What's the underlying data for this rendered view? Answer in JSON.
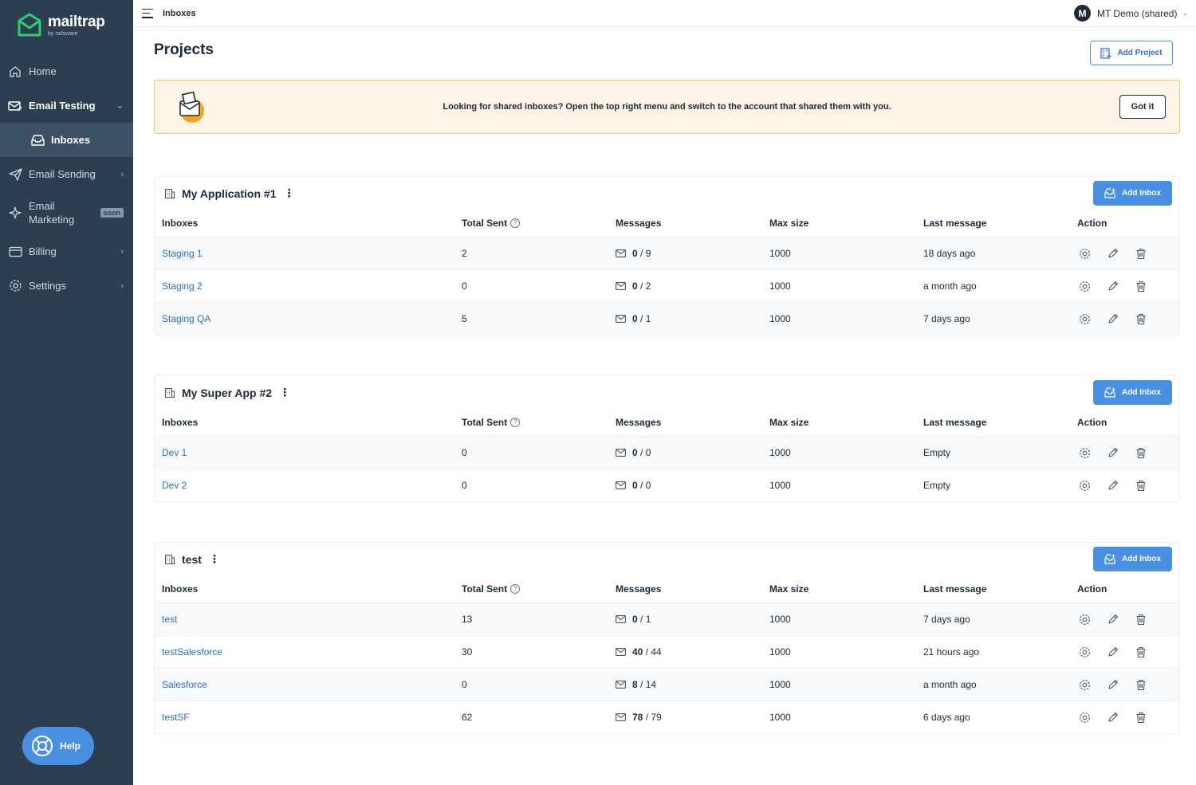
{
  "brand": {
    "name": "mailtrap",
    "sub": "by railsware"
  },
  "sidebar": {
    "items": [
      {
        "label": "Home"
      },
      {
        "label": "Email Testing"
      },
      {
        "label": "Inboxes"
      },
      {
        "label": "Email Sending"
      },
      {
        "label": "Email",
        "label2": "Marketing",
        "badge": "soon"
      },
      {
        "label": "Billing"
      },
      {
        "label": "Settings"
      }
    ],
    "help_label": "Help"
  },
  "topbar": {
    "breadcrumb": "Inboxes",
    "account": "MT Demo (shared)",
    "avatar_letter": "M"
  },
  "page": {
    "title": "Projects",
    "add_project_label": "Add Project",
    "banner_text": "Looking for shared inboxes? Open the top right menu and switch to the account that shared them with you.",
    "got_it_label": "Got it"
  },
  "table_headers": {
    "inboxes": "Inboxes",
    "total_sent": "Total Sent",
    "messages": "Messages",
    "max_size": "Max size",
    "last_message": "Last message",
    "action": "Action"
  },
  "add_inbox_label": "Add Inbox",
  "projects": [
    {
      "name": "My Application #1",
      "inboxes": [
        {
          "name": "Staging 1",
          "total_sent": "2",
          "msg_unread": "0",
          "msg_total": "9",
          "max_size": "1000",
          "last_message": "18 days ago"
        },
        {
          "name": "Staging 2",
          "total_sent": "0",
          "msg_unread": "0",
          "msg_total": "2",
          "max_size": "1000",
          "last_message": "a month ago"
        },
        {
          "name": "Staging QA",
          "total_sent": "5",
          "msg_unread": "0",
          "msg_total": "1",
          "max_size": "1000",
          "last_message": "7 days ago"
        }
      ]
    },
    {
      "name": "My Super App #2",
      "inboxes": [
        {
          "name": "Dev 1",
          "total_sent": "0",
          "msg_unread": "0",
          "msg_total": "0",
          "max_size": "1000",
          "last_message": "Empty"
        },
        {
          "name": "Dev 2",
          "total_sent": "0",
          "msg_unread": "0",
          "msg_total": "0",
          "max_size": "1000",
          "last_message": "Empty"
        }
      ]
    },
    {
      "name": "test",
      "inboxes": [
        {
          "name": "test",
          "total_sent": "13",
          "msg_unread": "0",
          "msg_total": "1",
          "max_size": "1000",
          "last_message": "7 days ago"
        },
        {
          "name": "testSalesforce",
          "total_sent": "30",
          "msg_unread": "40",
          "msg_total": "44",
          "max_size": "1000",
          "last_message": "21 hours ago"
        },
        {
          "name": "Salesforce",
          "total_sent": "0",
          "msg_unread": "8",
          "msg_total": "14",
          "max_size": "1000",
          "last_message": "a month ago"
        },
        {
          "name": "testSF",
          "total_sent": "62",
          "msg_unread": "78",
          "msg_total": "79",
          "max_size": "1000",
          "last_message": "6 days ago"
        }
      ]
    }
  ],
  "colors": {
    "sidebar": "#2c3e50",
    "accent": "#4a90e2",
    "link": "#2d6fc0",
    "banner_bg": "#fdf3e6",
    "banner_border": "#f0c47a"
  },
  "icons": [
    "menu-icon",
    "home-icon",
    "email-testing-icon",
    "inbox-icon",
    "send-icon",
    "sparkle-icon",
    "billing-icon",
    "settings-icon",
    "help-icon",
    "building-icon",
    "envelope-icon",
    "gear-icon",
    "pencil-icon",
    "trash-icon",
    "question-icon"
  ]
}
